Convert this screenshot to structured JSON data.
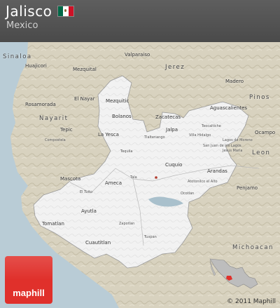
{
  "header": {
    "title": "Jalisco",
    "subtitle": "Mexico",
    "flag_icon": "mexico-flag-icon"
  },
  "colors": {
    "header_bg": "#555555",
    "terrain": "#d8d2bf",
    "region": "#f2f2f2",
    "sea": "#b9ccd6",
    "brand": "#e0302b"
  },
  "labels": {
    "sinaloa": "Sinaloa",
    "huajicori": "Huajicori",
    "mezquital": "Mezquital",
    "valparaiso": "Valparaiso",
    "jerez": "Jerez",
    "madero": "Madero",
    "pinos": "Pinos",
    "aguascalientes": "Aguascalientes",
    "rosamorada": "Rosamorada",
    "el_nayar": "El Nayar",
    "mezquitic": "Mezquitic",
    "bolanos": "Bolanos",
    "zacatecas": "Zacatecas",
    "jalpa": "Jalpa",
    "nayarit": "Nayarit",
    "tepic": "Tepic",
    "la_yesca": "La Yesca",
    "tequila": "Tequila",
    "leon": "Leon",
    "ocampo": "Ocampo",
    "compostela": "Compostela",
    "mascota": "Mascota",
    "ameca": "Ameca",
    "cuquio": "Cuquio",
    "arandas": "Arandas",
    "penjamo": "Penjamo",
    "tomatlan": "Tomatlan",
    "ayutla": "Ayutla",
    "cuautitlan": "Cuautitlan",
    "michoacan": "Michoacan",
    "tlaltenango": "Tlaltenango",
    "teocaltiche": "Teocaltiche",
    "villa_hidalgo": "Villa Hidalgo",
    "lagos": "Lagos de Moreno",
    "san_juan": "San Juan de los Lagos",
    "jesus_maria": "Jesus Maria",
    "atotonilco": "Atotonilco el Alto",
    "ocotlan": "Ocotlan",
    "tala": "Tala",
    "el_tuito": "El Tuito",
    "zapotlan": "Zapotlan",
    "tuxpan": "Tuxpan"
  },
  "copyright": "© 2011 Maphill",
  "logo": {
    "text": "maphill"
  }
}
